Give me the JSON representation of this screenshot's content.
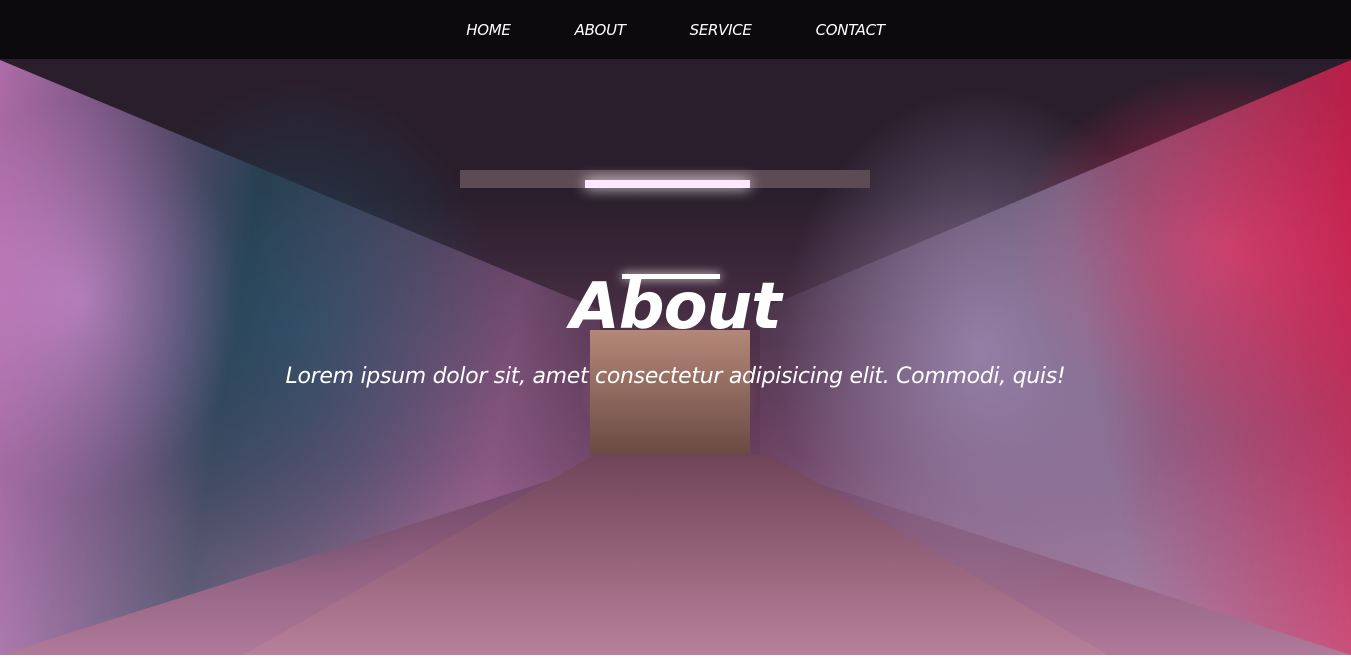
{
  "nav": {
    "items": [
      {
        "label": "HOME"
      },
      {
        "label": "ABOUT"
      },
      {
        "label": "SERVICE"
      },
      {
        "label": "CONTACT"
      }
    ]
  },
  "hero": {
    "title": "About",
    "subtitle": "Lorem ipsum dolor sit, amet consectetur adipisicing elit. Commodi, quis!",
    "background_image": "graffiti-tunnel-photo"
  },
  "colors": {
    "nav_bg": "#0c0a0d",
    "text": "#ffffff"
  }
}
